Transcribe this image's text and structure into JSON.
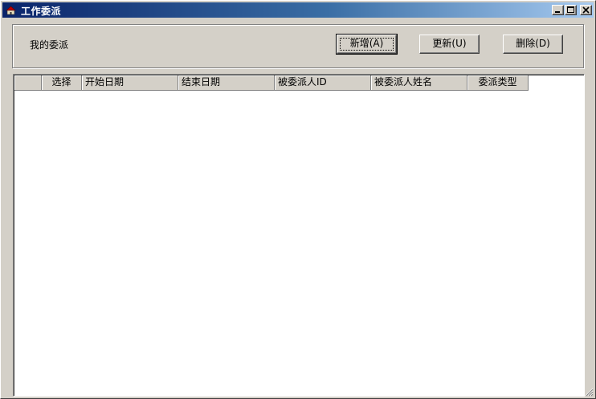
{
  "window": {
    "title": "工作委派",
    "app_icon": "app-icon",
    "controls": [
      "minimize-icon",
      "maximize-icon",
      "close-icon"
    ]
  },
  "toolbar": {
    "label": "我的委派",
    "add_label": "新增(A)",
    "update_label": "更新(U)",
    "delete_label": "删除(D)"
  },
  "table": {
    "columns": [
      {
        "label": ""
      },
      {
        "label": "选择"
      },
      {
        "label": "开始日期"
      },
      {
        "label": "结束日期"
      },
      {
        "label": "被委派人ID"
      },
      {
        "label": "被委派人姓名"
      },
      {
        "label": "委派类型"
      }
    ],
    "rows": []
  },
  "colors": {
    "titlebar_start": "#0a246a",
    "titlebar_end": "#a6caf0",
    "face": "#d4d0c8",
    "grid_bg": "#ffffff"
  }
}
